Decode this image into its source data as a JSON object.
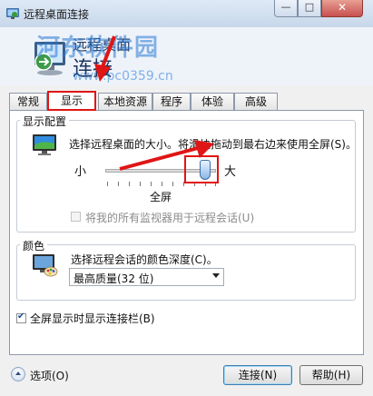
{
  "window": {
    "title": "远程桌面连接",
    "minimize_glyph": "—",
    "maximize_glyph": "□",
    "close_glyph": "✕"
  },
  "banner": {
    "line1": "远程桌面",
    "line2": "连接",
    "watermark": "河东软件园",
    "watermark_url": "www.pc0359.cn"
  },
  "tabs": [
    {
      "label": "常规",
      "active": false
    },
    {
      "label": "显示",
      "active": true
    },
    {
      "label": "本地资源",
      "active": false
    },
    {
      "label": "程序",
      "active": false
    },
    {
      "label": "体验",
      "active": false
    },
    {
      "label": "高级",
      "active": false
    }
  ],
  "display_config": {
    "title": "显示配置",
    "description": "选择远程桌面的大小。将滑块拖动到最右边来使用全屏(S)。",
    "slider_min_label": "小",
    "slider_max_label": "大",
    "slider_value_label": "全屏",
    "slider_position": 1.0,
    "multimon_checkbox_label": "将我的所有监视器用于远程会话(U)",
    "multimon_checked": false,
    "multimon_enabled": false
  },
  "colors": {
    "title": "颜色",
    "description": "选择远程会话的颜色深度(C)。",
    "selected": "最高质量(32 位)"
  },
  "connection_bar": {
    "label": "全屏显示时显示连接栏(B)",
    "checked": true
  },
  "footer": {
    "options_label": "选项(O)",
    "connect_label": "连接(N)",
    "help_label": "帮助(H)"
  },
  "accent": {
    "highlight": "#e01515",
    "title_bar": "#c7d7ea"
  },
  "icons": [
    "remote-desktop-icon",
    "monitor-icon",
    "palette-monitor-icon",
    "options-chevron-icon"
  ]
}
